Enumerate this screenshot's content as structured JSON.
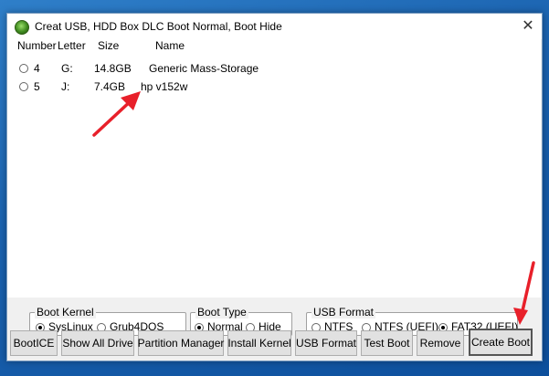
{
  "window": {
    "title": "Creat USB, HDD Box DLC Boot Normal, Boot Hide",
    "close_glyph": "✕"
  },
  "drive_list": {
    "columns": [
      "Number",
      "Letter",
      "Size",
      "Name"
    ],
    "rows": [
      {
        "number": "4",
        "letter": "G:",
        "size": "14.8GB",
        "name": "Generic Mass-Storage",
        "selected": false
      },
      {
        "number": "5",
        "letter": "J:",
        "size": "7.4GB",
        "name": "hp v152w",
        "selected": false
      }
    ]
  },
  "boot_kernel": {
    "label": "Boot Kernel",
    "options": [
      {
        "label": "SysLinux",
        "selected": true
      },
      {
        "label": "Grub4DOS",
        "selected": false
      }
    ]
  },
  "boot_type": {
    "label": "Boot Type",
    "options": [
      {
        "label": "Normal",
        "selected": true
      },
      {
        "label": "Hide",
        "selected": false
      }
    ]
  },
  "usb_format": {
    "label": "USB Format",
    "options": [
      {
        "label": "NTFS",
        "selected": false
      },
      {
        "label": "NTFS (UEFI)",
        "selected": false
      },
      {
        "label": "FAT32 (UEFI)",
        "selected": true
      }
    ]
  },
  "buttons": {
    "bootice": "BootICE",
    "show_all": "Show All Drive",
    "partition_manager": "Partition Manager",
    "install_kernel": "Install Kernel",
    "usb_format": "USB Format",
    "test_boot": "Test Boot",
    "remove": "Remove",
    "create_boot": "Create Boot"
  },
  "colors": {
    "annotation_arrow": "#e8202a",
    "desktop_blue": "#1b63b0"
  }
}
